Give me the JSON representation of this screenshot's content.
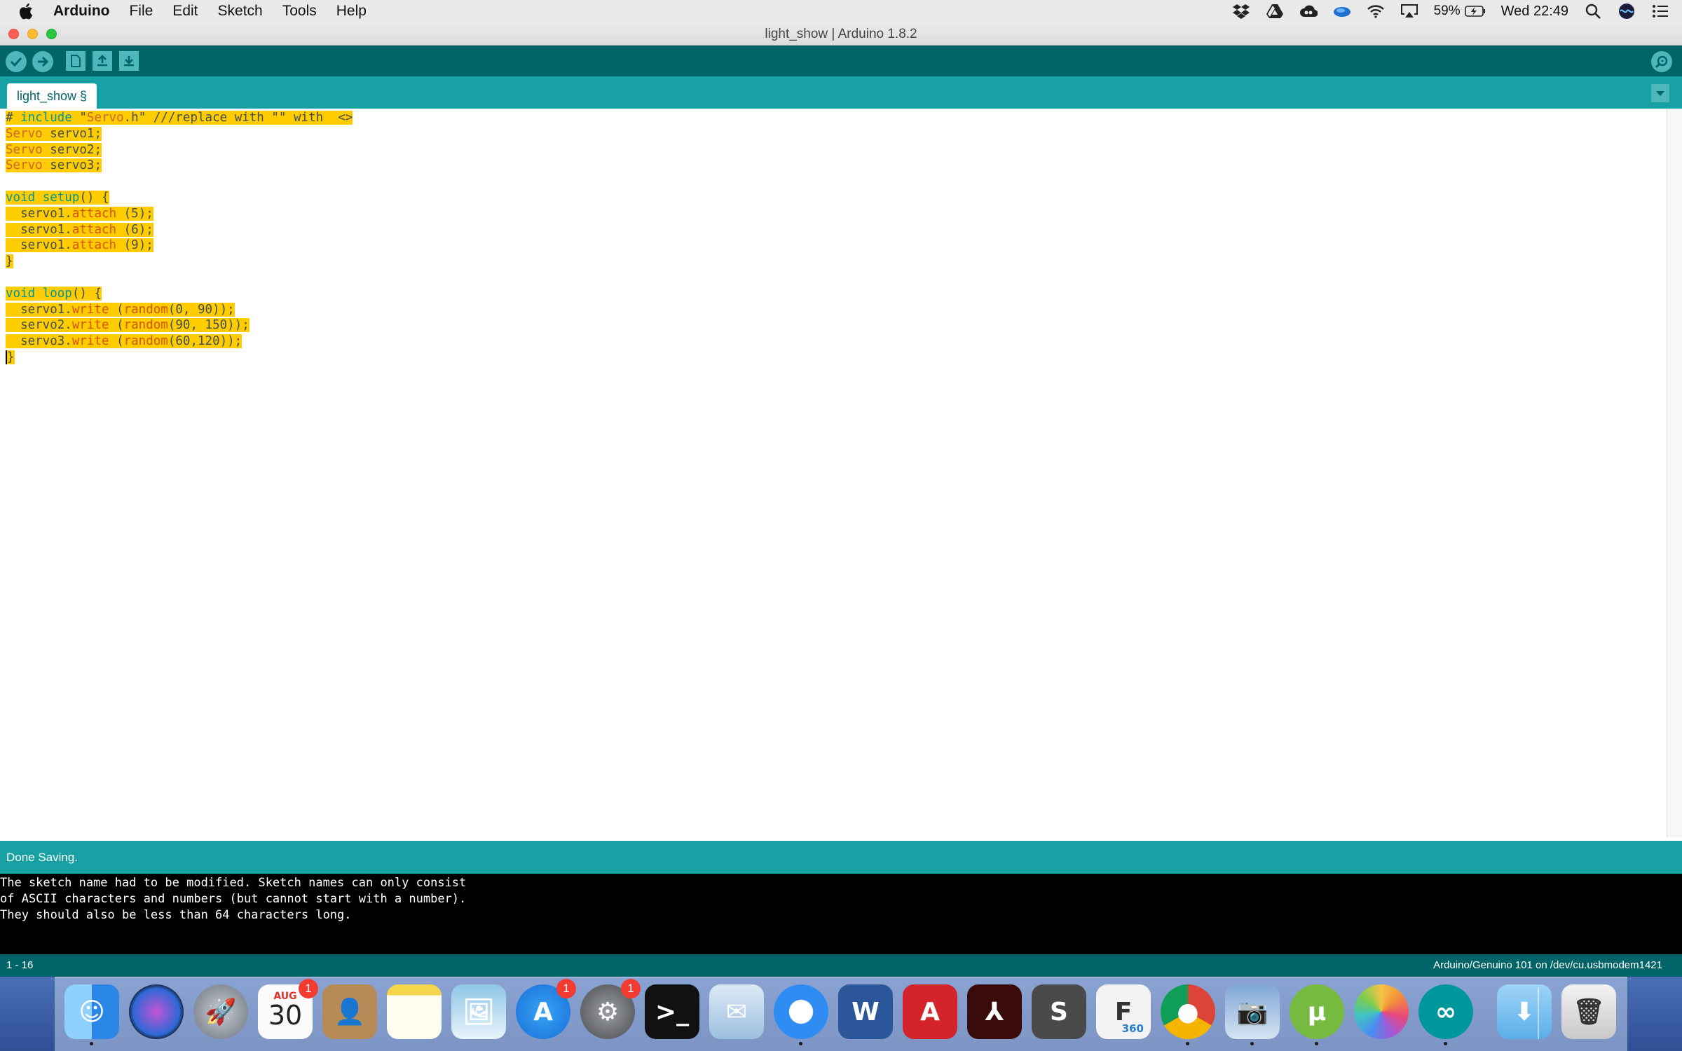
{
  "menubar": {
    "app_name": "Arduino",
    "items": [
      "File",
      "Edit",
      "Sketch",
      "Tools",
      "Help"
    ],
    "battery": "59%",
    "clock": "Wed 22:49",
    "status_icons": [
      "dropbox-icon",
      "google-drive-icon",
      "creative-cloud-icon",
      "onedrive-icon",
      "wifi-icon",
      "airplay-icon",
      "battery-icon",
      "spotlight-icon",
      "siri-icon",
      "notification-center-icon"
    ]
  },
  "window": {
    "title": "light_show | Arduino 1.8.2"
  },
  "toolbar": {
    "buttons": [
      "verify-icon",
      "upload-icon",
      "new-icon",
      "open-icon",
      "save-icon",
      "serial-monitor-icon"
    ]
  },
  "tabs": [
    {
      "label": "light_show §"
    }
  ],
  "editor": {
    "lines": [
      "# include \"Servo.h\" ///replace with \"\" with  <>",
      "Servo servo1;",
      "Servo servo2;",
      "Servo servo3;",
      "",
      "void setup() {",
      "  servo1.attach (5);",
      "  servo1.attach (6);",
      "  servo1.attach (9);",
      "}",
      "",
      "void loop() {",
      "  servo1.write (random(0, 90));",
      "  servo2.write (random(90, 150));",
      "  servo3.write (random(60,120));",
      "}"
    ],
    "selection": "all lines highlighted"
  },
  "status": {
    "message": "Done Saving."
  },
  "console": {
    "lines": [
      "The sketch name had to be modified. Sketch names can only consist",
      "of ASCII characters and numbers (but cannot start with a number).",
      "They should also be less than 64 characters long."
    ]
  },
  "footer": {
    "line_range": "1 - 16",
    "board": "Arduino/Genuino 101 on /dev/cu.usbmodem1421"
  },
  "dock": {
    "apps": [
      {
        "name": "finder-icon",
        "running": true
      },
      {
        "name": "siri-icon",
        "running": false
      },
      {
        "name": "launchpad-icon",
        "running": false
      },
      {
        "name": "calendar-icon",
        "running": false,
        "month": "AUG",
        "day": "30",
        "badge": "1"
      },
      {
        "name": "contacts-icon",
        "running": false
      },
      {
        "name": "notes-icon",
        "running": false
      },
      {
        "name": "preview-icon",
        "running": false
      },
      {
        "name": "app-store-icon",
        "running": false,
        "badge": "1"
      },
      {
        "name": "system-preferences-icon",
        "running": false,
        "badge": "1"
      },
      {
        "name": "terminal-icon",
        "running": false
      },
      {
        "name": "mail-icon",
        "running": false
      },
      {
        "name": "safari-icon",
        "running": true
      },
      {
        "name": "word-icon",
        "running": false
      },
      {
        "name": "autocad-icon",
        "running": false
      },
      {
        "name": "acrobat-icon",
        "running": false
      },
      {
        "name": "sublime-text-icon",
        "running": false
      },
      {
        "name": "fusion-360-icon",
        "running": false,
        "label": "360"
      },
      {
        "name": "chrome-icon",
        "running": true
      },
      {
        "name": "image-capture-icon",
        "running": true
      },
      {
        "name": "utorrent-icon",
        "running": true
      },
      {
        "name": "photos-icon",
        "running": false
      },
      {
        "name": "arduino-icon",
        "running": true
      },
      {
        "name": "downloads-folder-icon",
        "running": false
      },
      {
        "name": "trash-icon",
        "running": false
      }
    ]
  }
}
